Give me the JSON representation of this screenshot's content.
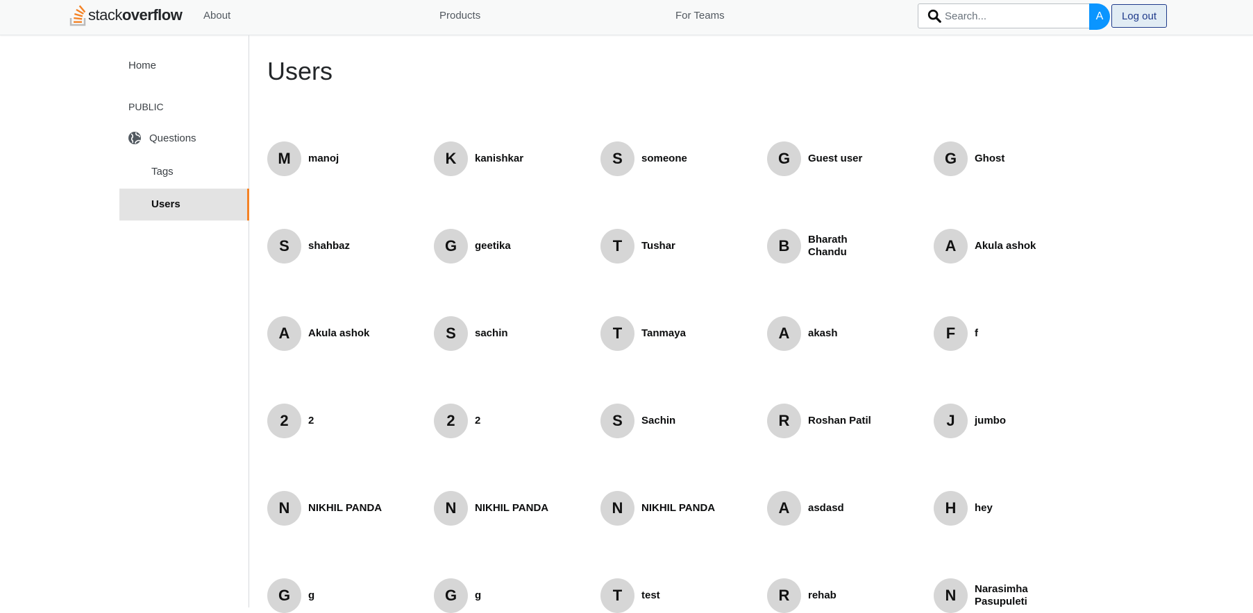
{
  "header": {
    "logo_prefix": "stack",
    "logo_bold": "overflow",
    "nav": {
      "about": "About",
      "products": "Products",
      "teams": "For Teams"
    },
    "search_placeholder": "Search...",
    "avatar_initial": "A",
    "logout_label": "Log out",
    "accent_color": "#f48225",
    "button_color": "#0a95ff"
  },
  "sidebar": {
    "home": "Home",
    "public": "PUBLIC",
    "questions": "Questions",
    "tags": "Tags",
    "users": "Users"
  },
  "main": {
    "title": "Users",
    "users": [
      {
        "initial": "M",
        "name": "manoj"
      },
      {
        "initial": "K",
        "name": "kanishkar"
      },
      {
        "initial": "S",
        "name": "someone"
      },
      {
        "initial": "G",
        "name": "Guest user"
      },
      {
        "initial": "G",
        "name": "Ghost"
      },
      {
        "initial": "S",
        "name": "shahbaz"
      },
      {
        "initial": "G",
        "name": "geetika"
      },
      {
        "initial": "T",
        "name": "Tushar"
      },
      {
        "initial": "B",
        "name": "Bharath Chandu"
      },
      {
        "initial": "A",
        "name": "Akula ashok"
      },
      {
        "initial": "A",
        "name": "Akula ashok"
      },
      {
        "initial": "S",
        "name": "sachin"
      },
      {
        "initial": "T",
        "name": "Tanmaya"
      },
      {
        "initial": "A",
        "name": "akash"
      },
      {
        "initial": "F",
        "name": "f"
      },
      {
        "initial": "2",
        "name": "2"
      },
      {
        "initial": "2",
        "name": "2"
      },
      {
        "initial": "S",
        "name": "Sachin"
      },
      {
        "initial": "R",
        "name": "Roshan Patil"
      },
      {
        "initial": "J",
        "name": "jumbo"
      },
      {
        "initial": "N",
        "name": "NIKHIL PANDA"
      },
      {
        "initial": "N",
        "name": "NIKHIL PANDA"
      },
      {
        "initial": "N",
        "name": "NIKHIL PANDA"
      },
      {
        "initial": "A",
        "name": "asdasd"
      },
      {
        "initial": "H",
        "name": "hey"
      },
      {
        "initial": "G",
        "name": "g"
      },
      {
        "initial": "G",
        "name": "g"
      },
      {
        "initial": "T",
        "name": "test"
      },
      {
        "initial": "R",
        "name": "rehab"
      },
      {
        "initial": "N",
        "name": "Narasimha Pasupuleti"
      }
    ]
  }
}
